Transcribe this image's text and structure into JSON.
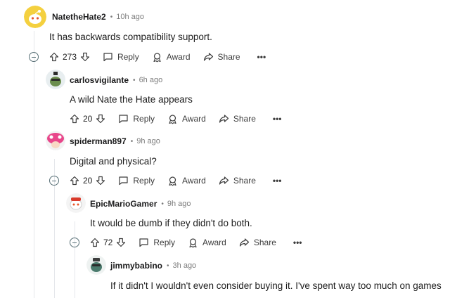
{
  "actions": {
    "reply": "Reply",
    "award": "Award",
    "share": "Share",
    "more": "•••"
  },
  "comments": [
    {
      "username": "NatetheHate2",
      "time": "10h ago",
      "text": "It has backwards compatibility support.",
      "votes": "273"
    },
    {
      "username": "carlosvigilante",
      "time": "6h ago",
      "text": "A wild Nate the Hate appears",
      "votes": "20"
    },
    {
      "username": "spiderman897",
      "time": "9h ago",
      "text": "Digital and physical?",
      "votes": "20"
    },
    {
      "username": "EpicMarioGamer",
      "time": "9h ago",
      "text": "It would be dumb if they didn't do both.",
      "votes": "72"
    },
    {
      "username": "jimmybabino",
      "time": "3h ago",
      "text": "If it didn't I wouldn't even consider buying it. I've spent way too much on games"
    }
  ]
}
